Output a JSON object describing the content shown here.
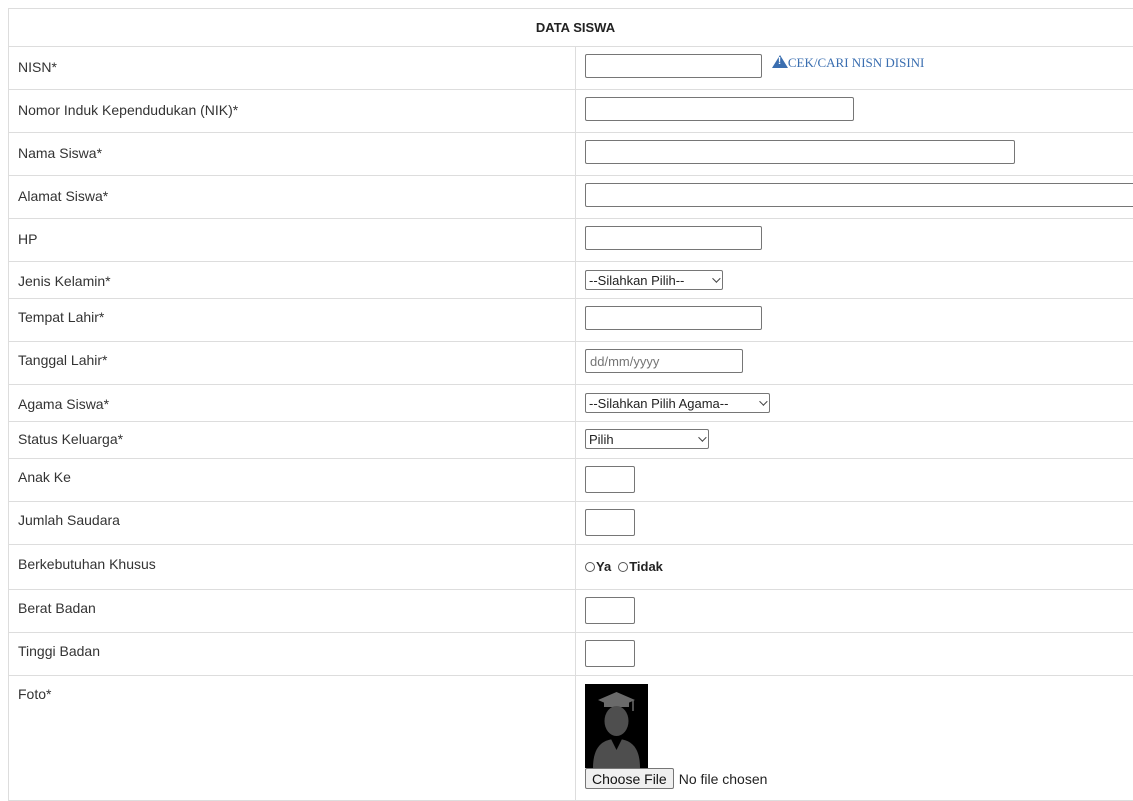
{
  "form": {
    "title": "DATA SISWA",
    "nisn": {
      "label": "NISN*",
      "value": "",
      "check_link": "CEK/CARI NISN DISINI"
    },
    "nik": {
      "label": "Nomor Induk Kependudukan (NIK)*",
      "value": ""
    },
    "nama": {
      "label": "Nama Siswa*",
      "value": ""
    },
    "alamat": {
      "label": "Alamat Siswa*",
      "value": ""
    },
    "hp": {
      "label": "HP",
      "value": ""
    },
    "jenis_kelamin": {
      "label": "Jenis Kelamin*",
      "selected": "--Silahkan Pilih--"
    },
    "tempat_lahir": {
      "label": "Tempat Lahir*",
      "value": ""
    },
    "tanggal_lahir": {
      "label": "Tanggal Lahir*",
      "placeholder": "dd/mm/yyyy"
    },
    "agama": {
      "label": "Agama Siswa*",
      "selected": "--Silahkan Pilih Agama--"
    },
    "status_keluarga": {
      "label": "Status Keluarga*",
      "selected": "Pilih"
    },
    "anak_ke": {
      "label": "Anak Ke",
      "value": ""
    },
    "jumlah_saudara": {
      "label": "Jumlah Saudara",
      "value": ""
    },
    "berkebutuhan": {
      "label": "Berkebutuhan Khusus",
      "options": [
        "Ya",
        "Tidak"
      ]
    },
    "berat_badan": {
      "label": "Berat Badan",
      "value": ""
    },
    "tinggi_badan": {
      "label": "Tinggi Badan",
      "value": ""
    },
    "foto": {
      "label": "Foto*",
      "button": "Choose File",
      "status": "No file chosen"
    }
  },
  "colors": {
    "link": "#3a6eb0",
    "border": "#dddddd"
  }
}
